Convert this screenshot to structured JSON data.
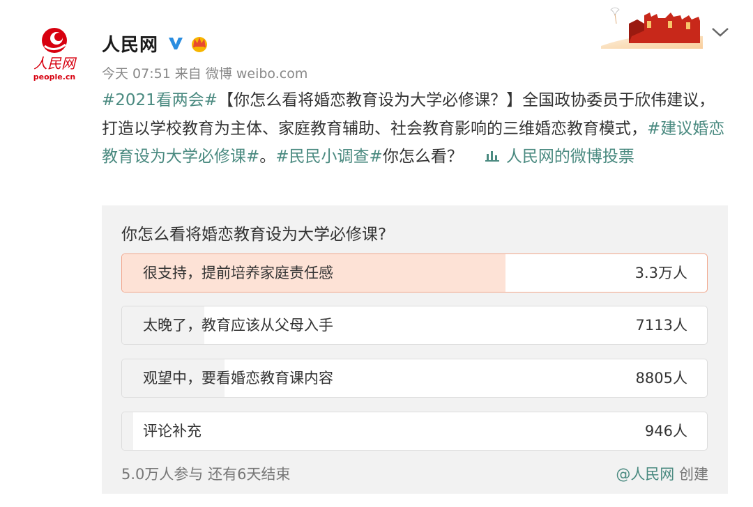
{
  "header": {
    "logo_text": "人民网",
    "logo_subtext": "people.cn",
    "author_name": "人民网",
    "verified_icon": "verified-v-icon",
    "crown_icon": "vip-crown-icon",
    "banner_icon": "great-wall-banner",
    "menu_icon": "chevron-down-icon"
  },
  "meta": {
    "time": "今天 07:51",
    "from_label": "来自",
    "source": "微博 weibo.com"
  },
  "post": {
    "hashtag_1": "#2021看两会#",
    "text_1": "【你怎么看将婚恋教育设为大学必修课？】全国政协委员于欣伟建议，打造以学校教育为主体、家庭教育辅助、社会教育影响的三维婚恋教育模式，",
    "hashtag_2": "#建议婚恋教育设为大学必修课#",
    "text_2": "。",
    "hashtag_3": "#民民小调查#",
    "text_3": "你怎么看？",
    "vote_link": "人民网的微博投票",
    "vote_icon": "vote-chart-icon"
  },
  "poll": {
    "question": "你怎么看将婚恋教育设为大学必修课?",
    "options": [
      {
        "label": "很支持，提前培养家庭责任感",
        "count": "3.3万人",
        "share": 0.656,
        "top": true
      },
      {
        "label": "太晚了，教育应该从父母入手",
        "count": "7113人",
        "share": 0.141,
        "top": false
      },
      {
        "label": "观望中，要看婚恋教育课内容",
        "count": "8805人",
        "share": 0.175,
        "top": false
      },
      {
        "label": "评论补充",
        "count": "946人",
        "share": 0.019,
        "top": false
      }
    ],
    "participants": "5.0万人参与",
    "remaining": "还有6天结束",
    "creator": "@人民网",
    "created_label": "创建"
  },
  "colors": {
    "link": "#4a8a80",
    "top_option_fill": "#fde2d6",
    "top_option_border": "#f2a58a",
    "option_fill": "#f2f2f2",
    "brand_red": "#d7000f"
  }
}
